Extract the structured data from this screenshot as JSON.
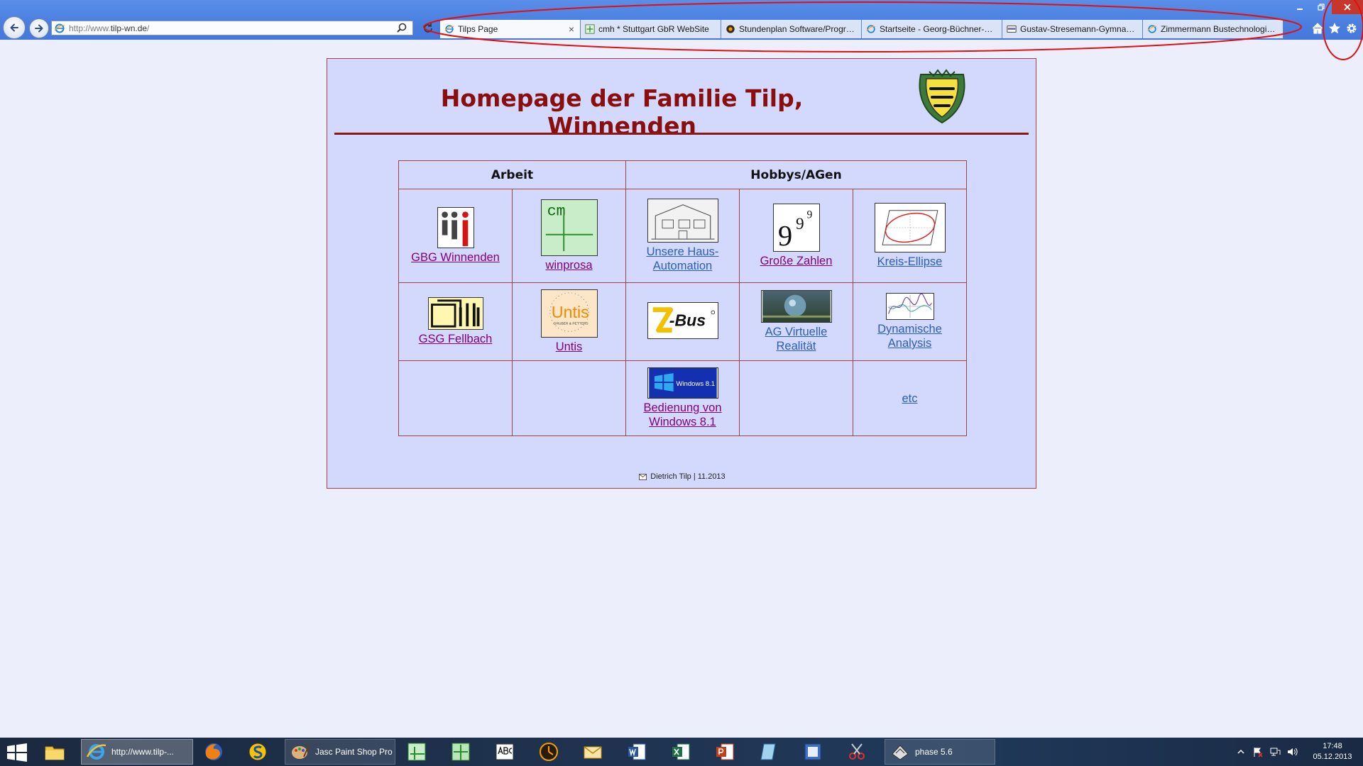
{
  "browser": {
    "url_prefix": "http://www.",
    "url_main": "tilp-wn.de",
    "url_suffix": "/",
    "tabs": [
      {
        "title": "Tilps Page",
        "active": true,
        "close": "×"
      },
      {
        "title": "cmh * Stuttgart GbR WebSite"
      },
      {
        "title": "Stundenplan Software/Progra..."
      },
      {
        "title": "Startseite - Georg-Büchner-Gy..."
      },
      {
        "title": "Gustav-Stresemann-Gymnasiu..."
      },
      {
        "title": "Zimmermann Bustechnologie ..."
      }
    ],
    "annotation_color": "#e01010"
  },
  "page": {
    "title": "Homepage der Familie Tilp, Winnenden",
    "title_color": "#8a0e0e",
    "background": "#d2d9fd",
    "headers": {
      "work": "Arbeit",
      "hobbies": "Hobbys/AGen"
    },
    "cells": {
      "gbg": "GBG Winnenden",
      "winprosa": "winprosa",
      "hausautomation": "Unsere Haus-Automation",
      "grosse_zahlen": "Große Zahlen",
      "kreis_ellipse": "Kreis-Ellipse",
      "gsg": "GSG Fellbach",
      "untis": "Untis",
      "ag_vr": "AG Virtuelle Realität",
      "dyn_analysis": "Dynamische Analysis",
      "windows81": "Bedienung von Windows 8.1",
      "etc": "etc"
    },
    "thumb_text": {
      "cm": "cm",
      "untis": "Untis",
      "untis_sub": "GRUBER & PETTERS",
      "zbus": "-Bus",
      "nine": "9",
      "exp": "9",
      "exp2": "9",
      "win81": "Windows 8.1"
    },
    "footer": "Dietrich Tilp | 11.2013"
  },
  "taskbar": {
    "ie_label": "http://www.tilp-...",
    "psp_label": "Jasc Paint Shop Pro",
    "phase_label": "phase 5.6",
    "time": "17:48",
    "date": "05.12.2013"
  }
}
